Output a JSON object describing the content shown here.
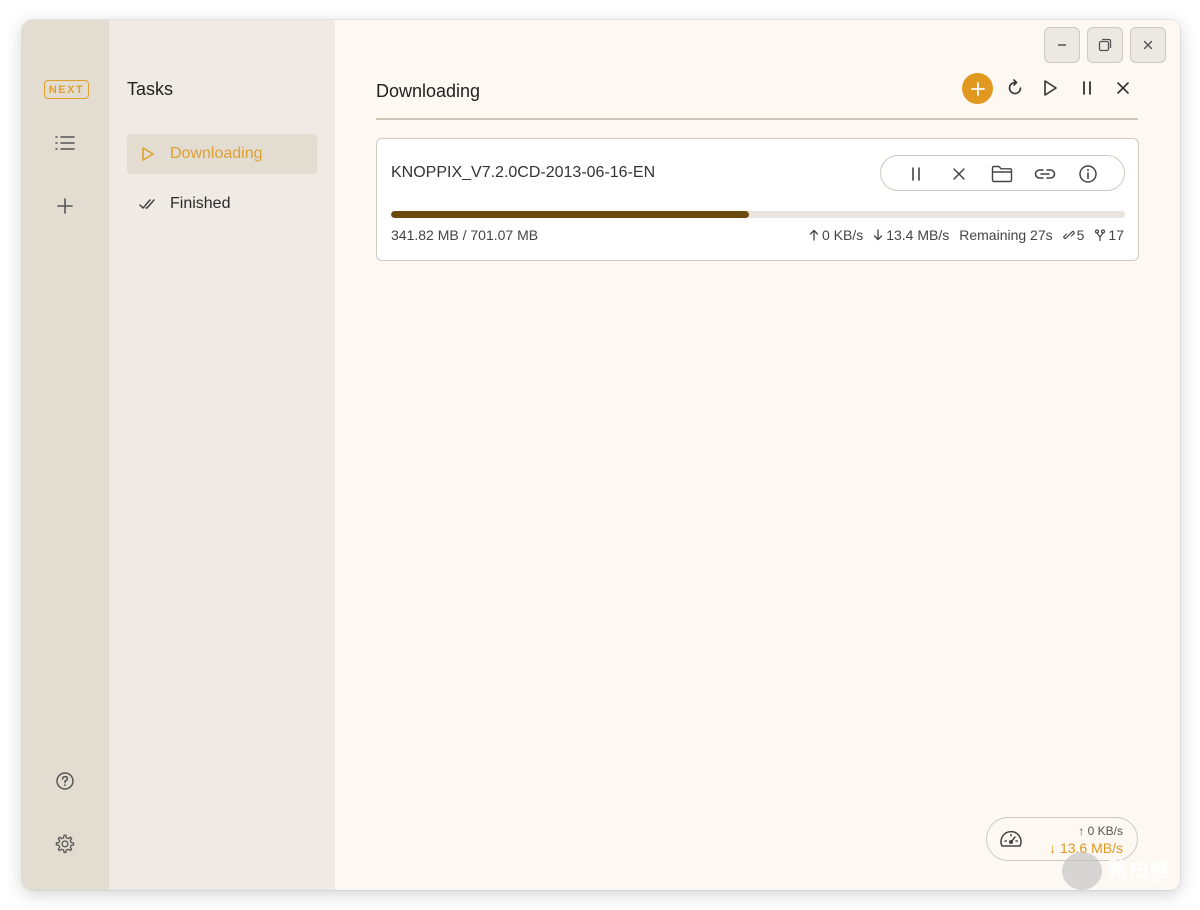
{
  "rail": {
    "logo": "NEXT",
    "icons": [
      "list-icon",
      "plus-icon",
      "help-icon",
      "gear-icon"
    ]
  },
  "sidebar": {
    "title": "Tasks",
    "items": [
      {
        "label": "Downloading",
        "icon": "play-outline-icon",
        "active": true
      },
      {
        "label": "Finished",
        "icon": "double-check-icon",
        "active": false
      }
    ]
  },
  "main": {
    "heading": "Downloading",
    "toolbar": [
      "add-icon",
      "refresh-icon",
      "resume-all-icon",
      "pause-all-icon",
      "delete-all-icon"
    ]
  },
  "task": {
    "name": "KNOPPIX_V7.2.0CD-2013-06-16-EN",
    "progress": 0.4876,
    "size": "341.82 MB / 701.07 MB",
    "upload": "0 KB/s",
    "download": "13.4 MB/s",
    "remaining": "Remaining 27s",
    "connections": "5",
    "peers": "17",
    "actions": [
      "pause-icon",
      "close-icon",
      "folder-icon",
      "link-icon",
      "info-icon"
    ]
  },
  "speed": {
    "up": "0 KB/s",
    "down": "13.6 MB/s"
  },
  "watermark": {
    "title": "路由器",
    "sub": "luyouqi.com"
  },
  "colors": {
    "accent": "#e0981e",
    "rail_bg": "#e2dcd1",
    "sidebar_bg": "#efebe4",
    "main_bg": "#fdf8f2",
    "progress_fill": "#6b4a0f"
  }
}
